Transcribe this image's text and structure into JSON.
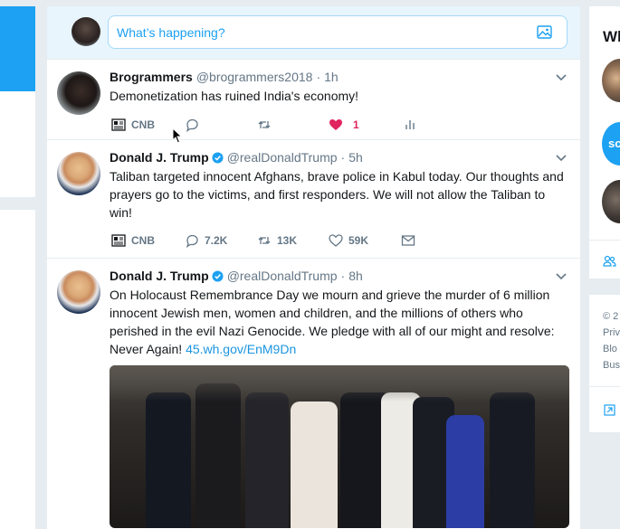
{
  "composer": {
    "placeholder": "What’s happening?",
    "image_icon": "image-icon"
  },
  "tweets": [
    {
      "name": "Brogrammers",
      "handle": "@brogrammers2018",
      "dot": "·",
      "time": "1h",
      "verified": false,
      "text": "Demonetization has ruined India's economy!",
      "actions": {
        "card": "CNB",
        "reply": "",
        "retweet": "",
        "like": "1",
        "liked": true,
        "analytics_icon": "bar-chart-icon"
      }
    },
    {
      "name": "Donald J. Trump",
      "handle": "@realDonaldTrump",
      "dot": "·",
      "time": "5h",
      "verified": true,
      "text": "Taliban targeted innocent Afghans, brave police in Kabul today. Our thoughts and prayers go to the victims, and first responders. We will not allow the Taliban to win!",
      "actions": {
        "card": "CNB",
        "reply": "7.2K",
        "retweet": "13K",
        "like": "59K",
        "dm_icon": "envelope-icon"
      }
    },
    {
      "name": "Donald J. Trump",
      "handle": "@realDonaldTrump",
      "dot": "·",
      "time": "8h",
      "verified": true,
      "text": "On Holocaust Remembrance Day we mourn and grieve the murder of 6 million innocent Jewish men, women and children, and the millions of others who perished in the evil Nazi Genocide. We pledge with all of our might and resolve: Never Again!",
      "link": "45.wh.gov/EnM9Dn"
    }
  ],
  "right": {
    "heading": "Wh",
    "badge": "sc",
    "footer_lines": [
      "© 2",
      "Priv",
      "Blo",
      "Bus"
    ]
  },
  "colors": {
    "accent": "#1da1f2",
    "like_red": "#e0245e",
    "muted": "#657786",
    "background": "#e6ecf0"
  }
}
